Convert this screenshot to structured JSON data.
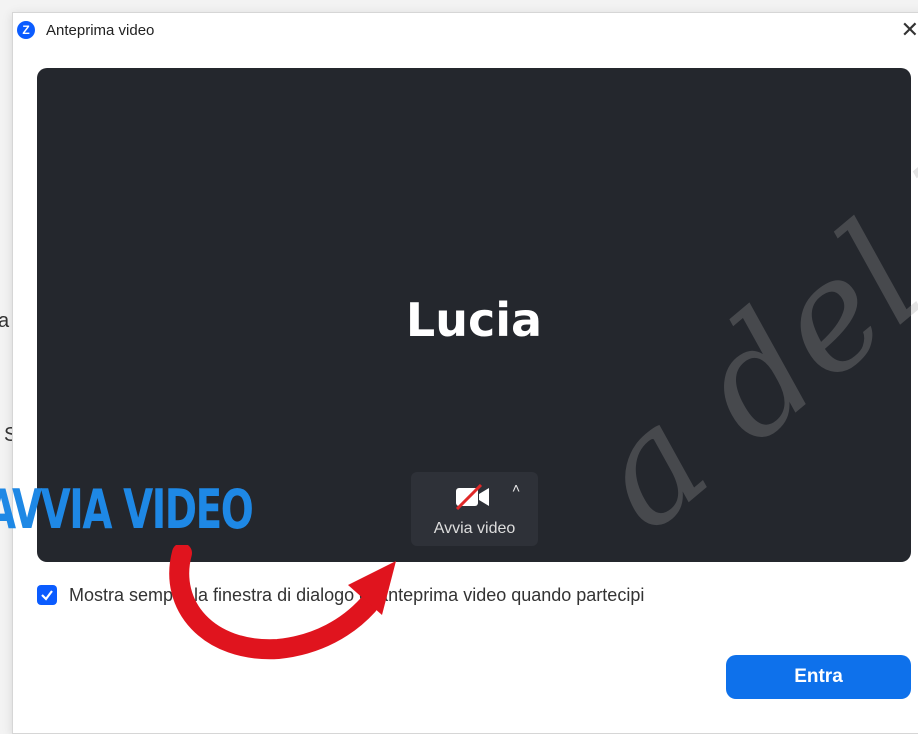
{
  "background": {
    "letter_1": "a",
    "letter_2": "S"
  },
  "window": {
    "title": "Anteprima video",
    "app_icon": "Z",
    "close": "✕"
  },
  "preview": {
    "user_name": "Lucia"
  },
  "video_control": {
    "label": "Avvia video",
    "icon": "camera-off-icon",
    "expand": "˄"
  },
  "options": {
    "always_show_preview_checked": true,
    "always_show_preview_label": "Mostra sempre la finestra di dialogo di anteprima video quando partecipi"
  },
  "actions": {
    "enter_label": "Entra"
  },
  "annotation": {
    "text": "AVVIA VIDEO"
  },
  "watermark": {
    "text": "a del Li"
  },
  "colors": {
    "accent": "#0e71eb",
    "preview_bg": "#24272d",
    "annotation": "#1e88e5",
    "arrow": "#e0141e"
  }
}
